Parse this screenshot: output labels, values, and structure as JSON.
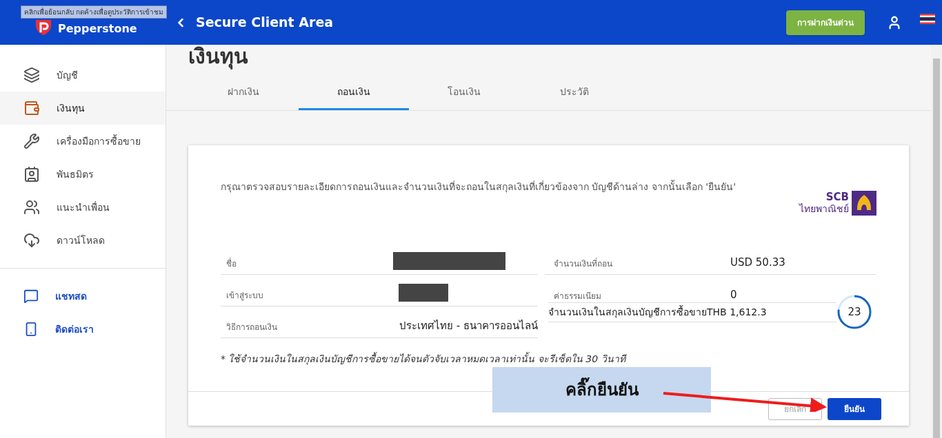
{
  "header": {
    "tooltip": "คลิกเพื่อย้อนกลับ กดค้างเพื่อดูประวัติการเข้าชม",
    "brand": "Pepperstone",
    "title": "Secure Client Area",
    "deposit_button": "การฝากเงินด่วน"
  },
  "sidebar": {
    "items": [
      {
        "label": "บัญชี",
        "selected": false
      },
      {
        "label": "เงินทุน",
        "selected": true
      },
      {
        "label": "เครื่องมือการซื้อขาย",
        "selected": false
      },
      {
        "label": "พันธมิตร",
        "selected": false
      },
      {
        "label": "แนะนำเพื่อน",
        "selected": false
      },
      {
        "label": "ดาวน์โหลด",
        "selected": false
      }
    ],
    "support_items": [
      {
        "label": "แชทสด"
      },
      {
        "label": "ติดต่อเรา"
      }
    ]
  },
  "page_title": "เงินทุน",
  "tabs": [
    {
      "label": "ฝากเงิน",
      "selected": false
    },
    {
      "label": "ถอนเงิน",
      "selected": true
    },
    {
      "label": "โอนเงิน",
      "selected": false
    },
    {
      "label": "ประวัติ",
      "selected": false
    }
  ],
  "card": {
    "instructions": "กรุณาตรวจสอบรายละเอียดการถอนเงินและจำนวนเงินที่จะถอนในสกุลเงินที่เกี่ยวข้องจาก บัญชีด้านล่าง จากนั้นเลือก 'ยืนยัน'",
    "bank_logo": {
      "name": "SCB",
      "local_name": "ไทยพาณิชย์"
    },
    "details_left": [
      {
        "label": "ชื่อ",
        "kind": "redacted"
      },
      {
        "label": "เข้าสู่ระบบ",
        "kind": "redacted"
      },
      {
        "label": "วิธีการถอนเงิน",
        "kind": "text",
        "value": "ประเทศไทย - ธนาคารออนไลน์"
      }
    ],
    "details_right": [
      {
        "label": "จำนวนเงินที่ถอน",
        "value": "USD 50.33"
      },
      {
        "label": "ค่าธรรมเนียม",
        "value": "0"
      }
    ],
    "converted_amount": "จำนวนเงินในสกุลเงินบัญชีการซื้อขายTHB 1,612.3",
    "timer": {
      "reading": "23",
      "level": 0.77
    },
    "note": "* ใช้จำนวนเงินในสกุลเงินบัญชีการซื้อขายได้จนตัวจับเวลาหมดเวลาเท่านั้น จะรีเซ็ตใน 30 วินาที",
    "buttons": [
      {
        "label": "ยกเลิก",
        "kind": "secondary",
        "disabled": true
      },
      {
        "label": "ยืนยัน",
        "kind": "primary",
        "disabled": false
      }
    ]
  },
  "annotation": {
    "text": "คลิ๊กยืนยัน"
  }
}
